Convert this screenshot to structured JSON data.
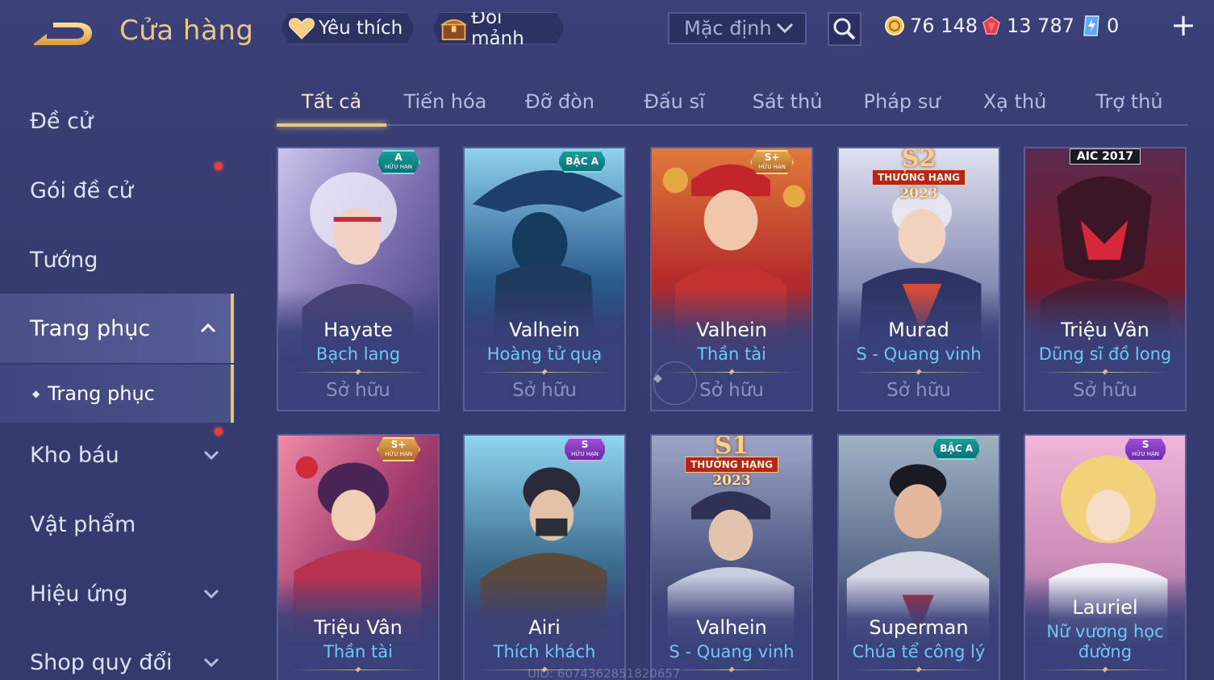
{
  "header": {
    "title": "Cửa hàng",
    "favorites_label": "Yêu thích",
    "exchange_label": "Đổi mảnh",
    "sort_value": "Mặc định",
    "currency": {
      "gold": "76 148",
      "ruby": "13 787",
      "voucher": "0"
    },
    "plus_label": "+"
  },
  "sidebar": {
    "items": [
      {
        "label": "Đề cử"
      },
      {
        "label": "Gói đề cử"
      },
      {
        "label": "Tướng"
      },
      {
        "label": "Trang phục"
      },
      {
        "label": "Trang phục"
      },
      {
        "label": "Kho báu"
      },
      {
        "label": "Vật phẩm"
      },
      {
        "label": "Hiệu ứng"
      },
      {
        "label": "Shop quy đổi"
      }
    ]
  },
  "tabs": [
    {
      "label": "Tất cả"
    },
    {
      "label": "Tiến hóa"
    },
    {
      "label": "Đỡ đòn"
    },
    {
      "label": "Đấu sĩ"
    },
    {
      "label": "Sát thủ"
    },
    {
      "label": "Pháp sư"
    },
    {
      "label": "Xạ thủ"
    },
    {
      "label": "Trợ thủ"
    }
  ],
  "cards": [
    {
      "hero": "Hayate",
      "skin": "Bạch lang",
      "status": "Sở hữu",
      "badge": "A",
      "badge_sub": "HỮU HẠN"
    },
    {
      "hero": "Valhein",
      "skin": "Hoàng tử quạ",
      "status": "Sở hữu",
      "badge": "BẬC A"
    },
    {
      "hero": "Valhein",
      "skin": "Thần tài",
      "status": "Sở hữu",
      "badge": "S+",
      "badge_sub": "HỮU HẠN"
    },
    {
      "hero": "Murad",
      "skin": "S - Quang vinh",
      "status": "Sở hữu",
      "ribbon": {
        "season": "S2",
        "label": "THƯỞNG HẠNG",
        "year": "2023"
      }
    },
    {
      "hero": "Triệu Vân",
      "skin": "Dũng sĩ đồ long",
      "status": "Sở hữu",
      "tag": "AIC 2017"
    },
    {
      "hero": "Triệu Vân",
      "skin": "Thần tài",
      "badge": "S+",
      "badge_sub": "HỮU HẠN"
    },
    {
      "hero": "Airi",
      "skin": "Thích khách",
      "badge": "S",
      "badge_sub": "HỮU HẠN"
    },
    {
      "hero": "Valhein",
      "skin": "S - Quang vinh",
      "ribbon": {
        "season": "S1",
        "label": "THƯỞNG HẠNG",
        "year": "2023"
      }
    },
    {
      "hero": "Superman",
      "skin": "Chúa tể công lý",
      "badge": "BẬC A"
    },
    {
      "hero": "Lauriel",
      "skin": "Nữ vương học đường",
      "badge": "S",
      "badge_sub": "HỮU HẠN"
    }
  ],
  "footer": {
    "uid": "UID: 6074362851820657"
  }
}
